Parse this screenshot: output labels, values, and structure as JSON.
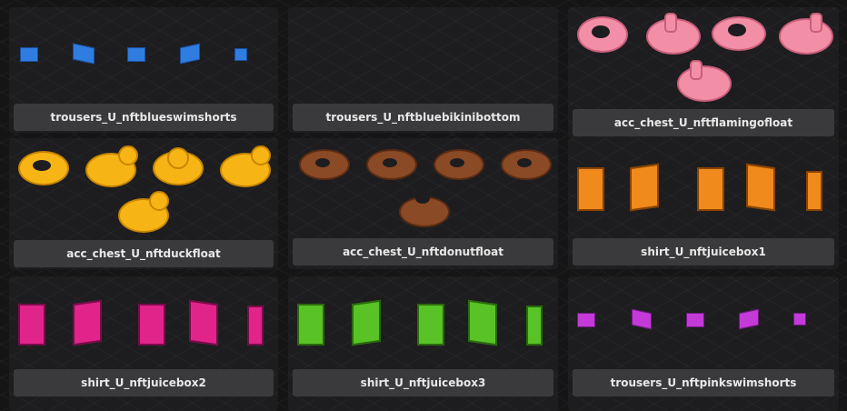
{
  "items": [
    {
      "label": "trousers_U_nftblueswimshorts",
      "icon": "blue-swim-shorts-icon",
      "color": "#2f7de0"
    },
    {
      "label": "trousers_U_nftbluebikinibottom",
      "icon": "blue-bikini-bottom-icon",
      "color": "#2f7de0"
    },
    {
      "label": "acc_chest_U_nftflamingofloat",
      "icon": "flamingo-float-icon",
      "color": "#f28fa6"
    },
    {
      "label": "acc_chest_U_nftduckfloat",
      "icon": "duck-float-icon",
      "color": "#f7b515"
    },
    {
      "label": "acc_chest_U_nftdonutfloat",
      "icon": "donut-float-icon",
      "color": "#8a4a26"
    },
    {
      "label": "shirt_U_nftjuicebox1",
      "icon": "orange-juicebox-icon",
      "color": "#f08a1c"
    },
    {
      "label": "shirt_U_nftjuicebox2",
      "icon": "strawberry-juicebox-icon",
      "color": "#e0248a"
    },
    {
      "label": "shirt_U_nftjuicebox3",
      "icon": "pear-juicebox-icon",
      "color": "#58c226"
    },
    {
      "label": "trousers_U_nftpinkswimshorts",
      "icon": "pink-swim-shorts-icon",
      "color": "#c43ad8"
    }
  ]
}
